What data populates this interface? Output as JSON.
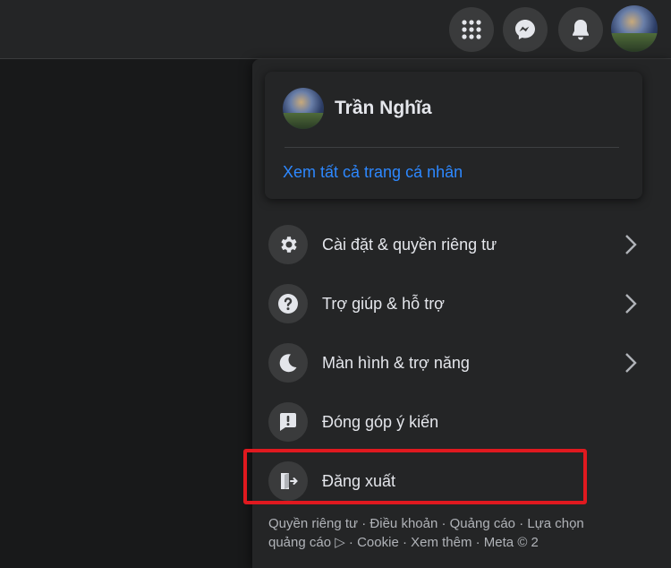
{
  "header": {
    "icons": [
      "apps-grid-icon",
      "messenger-icon",
      "bell-icon",
      "account-avatar"
    ]
  },
  "profile": {
    "name": "Trần Nghĩa",
    "see_all_link": "Xem tất cả trang cá nhân"
  },
  "menu": {
    "items": [
      {
        "label": "Cài đặt & quyền riêng tư",
        "icon": "gear-icon",
        "has_chevron": true
      },
      {
        "label": "Trợ giúp & hỗ trợ",
        "icon": "help-icon",
        "has_chevron": true
      },
      {
        "label": "Màn hình & trợ năng",
        "icon": "moon-icon",
        "has_chevron": true
      },
      {
        "label": "Đóng góp ý kiến",
        "icon": "feedback-icon",
        "has_chevron": false
      },
      {
        "label": "Đăng xuất",
        "icon": "logout-icon",
        "has_chevron": false
      }
    ]
  },
  "footer": {
    "line1": "Quyền riêng tư · Điều khoản · Quảng cáo · Lựa chọn",
    "line2": "quảng cáo ▷ · Cookie · Xem thêm · Meta © 2"
  },
  "colors": {
    "background": "#18191a",
    "surface": "#242526",
    "icon_circle": "#3a3b3c",
    "link": "#2d88ff",
    "highlight": "#e0191f"
  }
}
